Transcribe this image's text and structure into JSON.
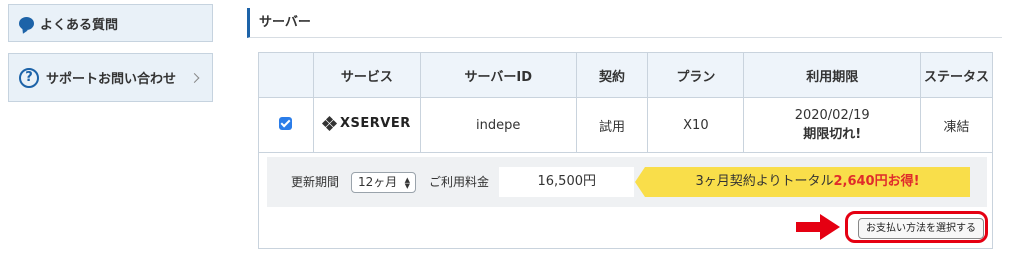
{
  "sidebar": {
    "faq_label": "よくある質問",
    "support_label": "サポートお問い合わせ"
  },
  "section": {
    "title": "サーバー"
  },
  "table": {
    "headers": [
      "",
      "サービス",
      "サーバーID",
      "契約",
      "プラン",
      "利用期限",
      "ステータス"
    ],
    "row": {
      "service": "XSERVER",
      "server_id": "indepe",
      "contract": "試用",
      "plan": "X10",
      "expiry_date": "2020/02/19",
      "expiry_note": "期限切れ!",
      "status": "凍結"
    }
  },
  "billing": {
    "period_label": "更新期間",
    "period_value": "12ヶ月",
    "fee_label": "ご利用料金",
    "fee_value": "16,500円",
    "banner_prefix": "3ヶ月契約よりトータル",
    "banner_highlight": "2,640円お得!",
    "pay_button": "お支払い方法を選択する"
  },
  "colors": {
    "accent": "#1d63a8",
    "alert_red": "#e02b2b",
    "banner_yellow": "#f9de4a",
    "highlight_ring": "#e50012"
  }
}
